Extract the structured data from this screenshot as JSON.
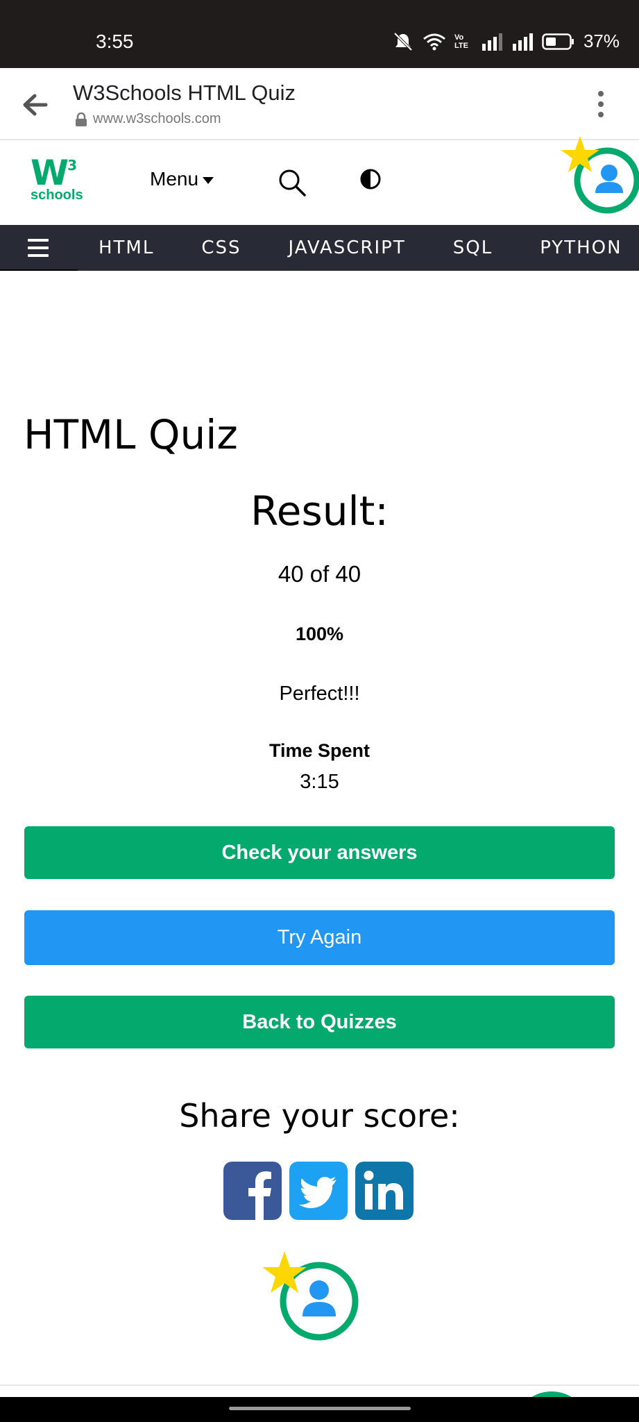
{
  "status_bar": {
    "time": "3:55",
    "volte": "Vo LTE",
    "battery": "37%"
  },
  "browser": {
    "title": "W3Schools HTML Quiz",
    "url": "www.w3schools.com"
  },
  "site_header": {
    "logo_mark": "W",
    "logo_sup": "3",
    "logo_text": "schools",
    "menu_label": "Menu"
  },
  "nav": {
    "items": [
      {
        "label": "HTML"
      },
      {
        "label": "CSS"
      },
      {
        "label": "JAVASCRIPT"
      },
      {
        "label": "SQL"
      },
      {
        "label": "PYTHON"
      }
    ]
  },
  "quiz": {
    "title": "HTML Quiz",
    "result_heading": "Result:",
    "score": "40 of 40",
    "percent": "100%",
    "message": "Perfect!!!",
    "time_label": "Time Spent",
    "time_value": "3:15"
  },
  "buttons": {
    "check": "Check your answers",
    "retry": "Try Again",
    "back": "Back to Quizzes"
  },
  "share": {
    "heading": "Share your score:",
    "networks": [
      "facebook-icon",
      "twitter-icon",
      "linkedin-icon"
    ]
  },
  "colors": {
    "w3_green": "#04aa6d",
    "blue": "#2196f3",
    "navbar": "#282a35",
    "status_bar": "#201c1b",
    "facebook": "#3b5998",
    "twitter": "#1da1f2",
    "linkedin": "#0e76a8",
    "star": "#ffd700"
  }
}
